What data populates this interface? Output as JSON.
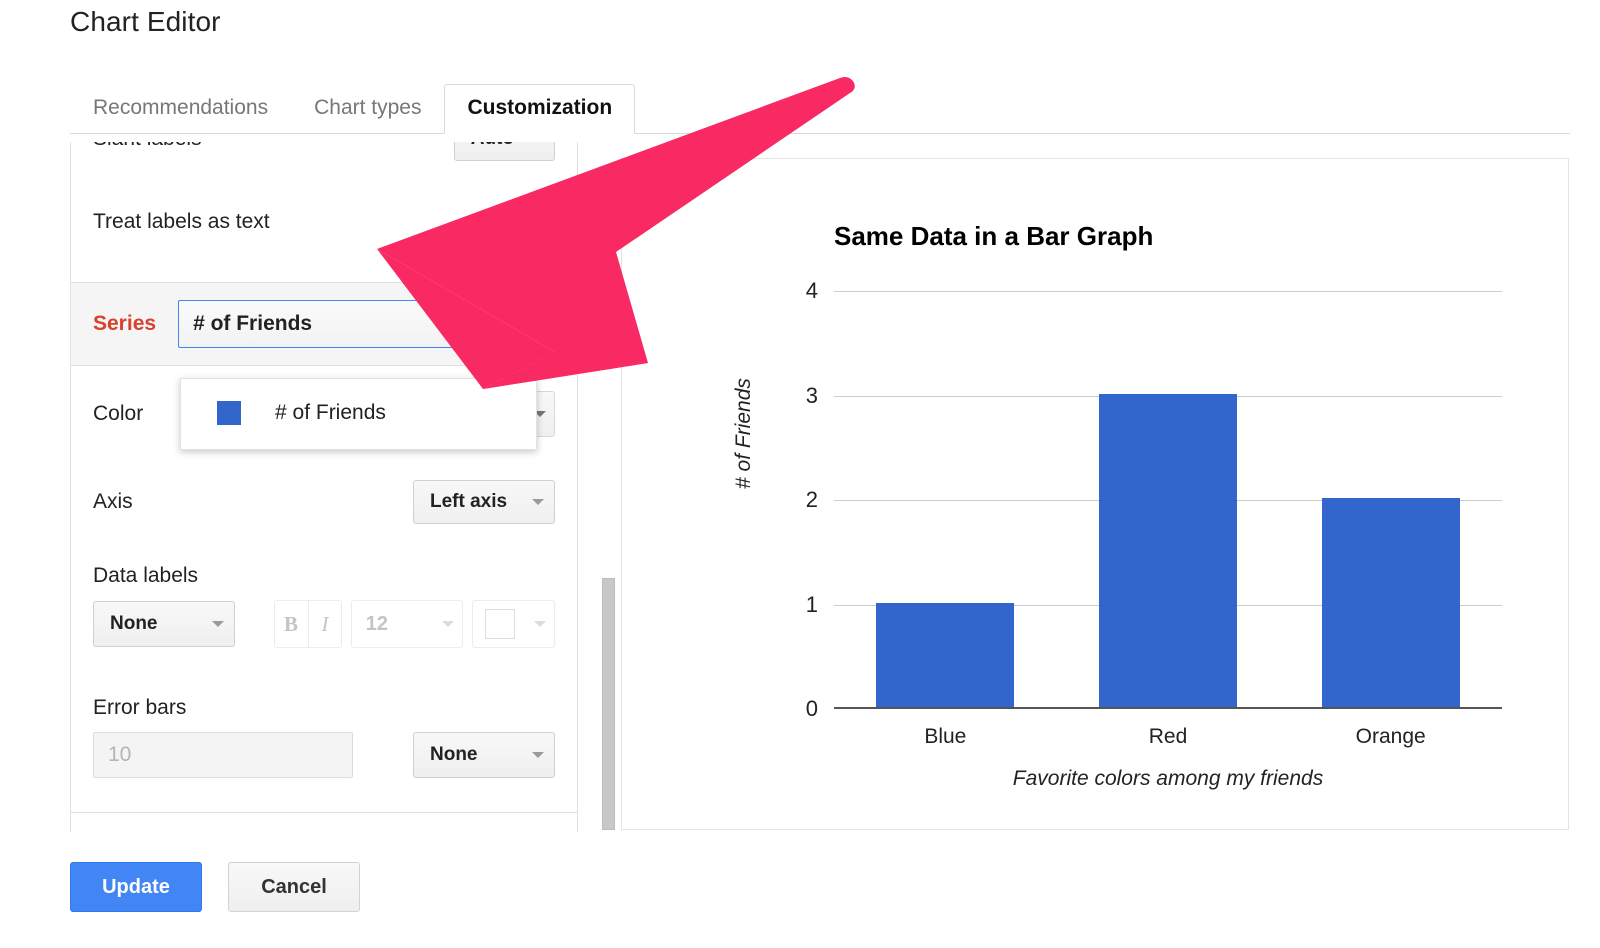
{
  "header": {
    "title": "Chart Editor"
  },
  "tabs": [
    {
      "label": "Recommendations",
      "active": false
    },
    {
      "label": "Chart types",
      "active": false
    },
    {
      "label": "Customization",
      "active": true
    }
  ],
  "settings": {
    "slant_labels": {
      "label": "Slant labels",
      "value": "Auto"
    },
    "treat_labels_as_text": {
      "label": "Treat labels as text",
      "checked": true
    },
    "series": {
      "label": "Series",
      "value": "# of Friends"
    },
    "series_dropdown": {
      "options": [
        {
          "label": "# of Friends",
          "swatch": "#3366cc"
        }
      ]
    },
    "color": {
      "label": "Color"
    },
    "axis": {
      "label": "Axis",
      "value": "Left axis"
    },
    "data_labels": {
      "label": "Data labels",
      "value": "None",
      "bold": "B",
      "italic": "I",
      "font_size": "12"
    },
    "error_bars": {
      "label": "Error bars",
      "amount_placeholder": "10",
      "type": "None"
    }
  },
  "footer": {
    "update_label": "Update",
    "cancel_label": "Cancel"
  },
  "chart_data": {
    "type": "bar",
    "title": "Same Data in a Bar Graph",
    "categories": [
      "Blue",
      "Red",
      "Orange"
    ],
    "values": [
      1,
      3,
      2
    ],
    "series": [
      {
        "name": "# of Friends",
        "values": [
          1,
          3,
          2
        ],
        "color": "#3366cc"
      }
    ],
    "xlabel": "Favorite colors among my friends",
    "ylabel": "# of Friends",
    "ylim": [
      0,
      4
    ],
    "yticks": [
      "4",
      "3",
      "2",
      "1",
      "0"
    ],
    "ytick_values": [
      4,
      3,
      2,
      1,
      0
    ],
    "grid": true,
    "legend": "none",
    "bar_color": "#3366cc"
  },
  "annotation": {
    "arrow_color": "#f92a63"
  }
}
